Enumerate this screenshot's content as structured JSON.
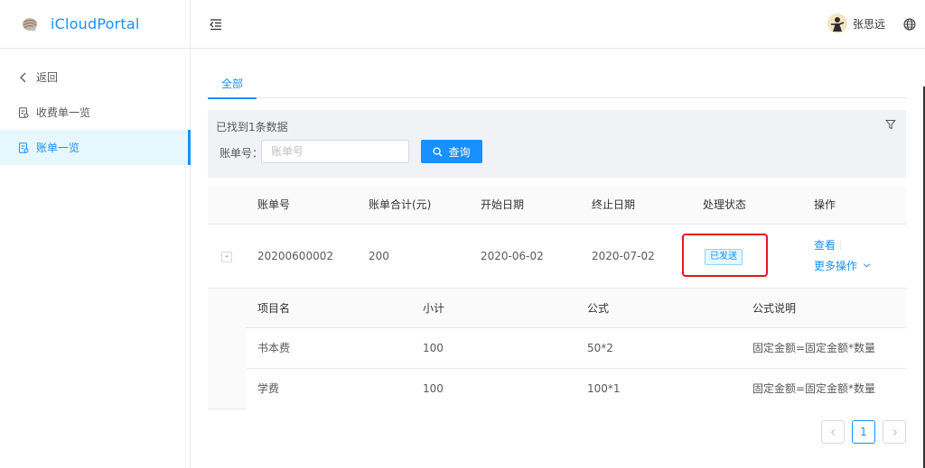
{
  "app": {
    "title": "iCloudPortal"
  },
  "sidebar": {
    "items": [
      {
        "label": "返回",
        "icon": "chevron-left-icon",
        "active": false
      },
      {
        "label": "收费单一览",
        "icon": "document-icon",
        "active": false
      },
      {
        "label": "账单一览",
        "icon": "document-icon",
        "active": true
      }
    ]
  },
  "header": {
    "user_name": "张思远"
  },
  "tabs": [
    {
      "label": "全部",
      "active": true
    }
  ],
  "search": {
    "found_text": "已找到1条数据",
    "field_label": "账单号：",
    "placeholder": "账单号",
    "value": "",
    "button_label": "查询"
  },
  "table": {
    "columns": [
      "账单号",
      "账单合计(元)",
      "开始日期",
      "终止日期",
      "处理状态",
      "操作"
    ],
    "rows": [
      {
        "expand_symbol": "-",
        "bill_no": "20200600002",
        "total": "200",
        "start_date": "2020-06-02",
        "end_date": "2020-07-02",
        "status": "已发送",
        "op_view": "查看",
        "op_more": "更多操作"
      }
    ]
  },
  "detail": {
    "columns": [
      "项目名",
      "小计",
      "公式",
      "公式说明"
    ],
    "rows": [
      {
        "name": "书本费",
        "subtotal": "100",
        "formula": "50*2",
        "desc": "固定金额=固定金额*数量"
      },
      {
        "name": "学费",
        "subtotal": "100",
        "formula": "100*1",
        "desc": "固定金额=固定金额*数量"
      }
    ]
  },
  "pagination": {
    "current_page": "1"
  },
  "colors": {
    "primary": "#1890ff",
    "highlight_border": "#e8141a",
    "panel_bg": "#f0f2f5"
  }
}
